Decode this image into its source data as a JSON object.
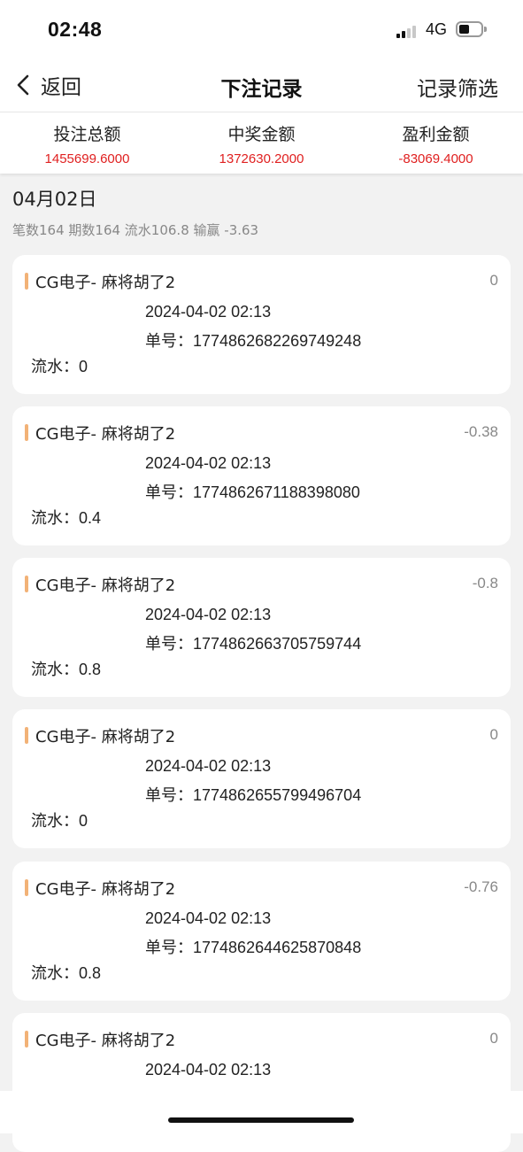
{
  "status_bar": {
    "time": "02:48",
    "network": "4G",
    "signal_icon": "signal-bars-icon",
    "battery_icon": "battery-icon"
  },
  "nav": {
    "back_label": "返回",
    "back_icon": "chevron-left-icon",
    "title": "下注记录",
    "filter_label": "记录筛选"
  },
  "summary": {
    "items": [
      {
        "label": "投注总额",
        "value": "1455699.6000"
      },
      {
        "label": "中奖金额",
        "value": "1372630.2000"
      },
      {
        "label": "盈利金额",
        "value": "-83069.4000"
      }
    ],
    "value_color": "#e02020"
  },
  "group": {
    "date": "04月02日",
    "stats": "笔数164 期数164 流水106.8 输赢 -3.63"
  },
  "labels": {
    "order_prefix": "单号：",
    "flow_prefix": "流水："
  },
  "accent_color": "#f2b277",
  "records": [
    {
      "title": "CG电子- 麻将胡了2",
      "amount": "0",
      "time": "2024-04-02 02:13",
      "order": "1774862682269749248",
      "flow": "0"
    },
    {
      "title": "CG电子- 麻将胡了2",
      "amount": "-0.38",
      "time": "2024-04-02 02:13",
      "order": "1774862671188398080",
      "flow": "0.4"
    },
    {
      "title": "CG电子- 麻将胡了2",
      "amount": "-0.8",
      "time": "2024-04-02 02:13",
      "order": "1774862663705759744",
      "flow": "0.8"
    },
    {
      "title": "CG电子- 麻将胡了2",
      "amount": "0",
      "time": "2024-04-02 02:13",
      "order": "1774862655799496704",
      "flow": "0"
    },
    {
      "title": "CG电子- 麻将胡了2",
      "amount": "-0.76",
      "time": "2024-04-02 02:13",
      "order": "1774862644625870848",
      "flow": "0.8"
    },
    {
      "title": "CG电子- 麻将胡了2",
      "amount": "0",
      "time": "2024-04-02 02:13",
      "order": "",
      "flow": ""
    }
  ]
}
